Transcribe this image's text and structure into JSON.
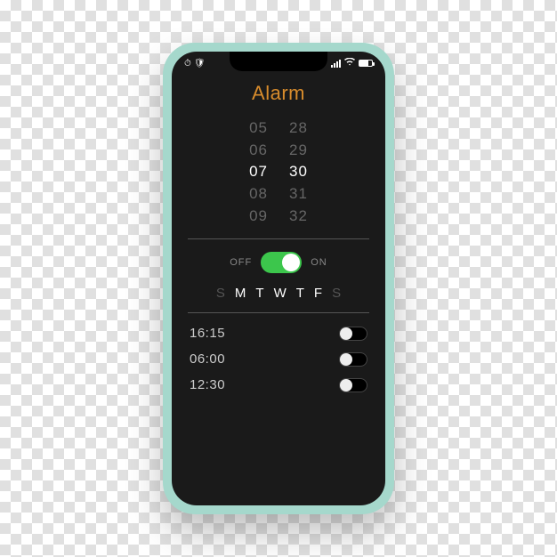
{
  "title": "Alarm",
  "status": {
    "time_left": "",
    "signal": "",
    "wifi": "",
    "battery": ""
  },
  "picker": {
    "hours": [
      "05",
      "06",
      "07",
      "08",
      "09"
    ],
    "minutes": [
      "28",
      "29",
      "30",
      "31",
      "32"
    ],
    "selected_index": 2
  },
  "toggle": {
    "off_label": "OFF",
    "on_label": "ON",
    "state": true
  },
  "days": [
    {
      "letter": "S",
      "active": false
    },
    {
      "letter": "M",
      "active": true
    },
    {
      "letter": "T",
      "active": true
    },
    {
      "letter": "W",
      "active": true
    },
    {
      "letter": "T",
      "active": true
    },
    {
      "letter": "F",
      "active": true
    },
    {
      "letter": "S",
      "active": false
    }
  ],
  "alarms": [
    {
      "time": "16:15",
      "enabled": false
    },
    {
      "time": "06:00",
      "enabled": false
    },
    {
      "time": "12:30",
      "enabled": false
    }
  ]
}
